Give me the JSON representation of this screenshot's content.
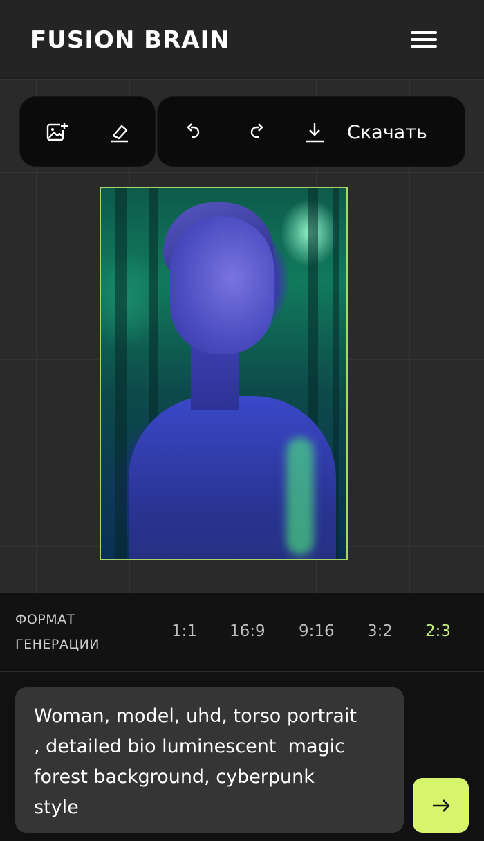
{
  "header": {
    "logo": "FUSION BRAIN",
    "menu_icon": "hamburger-menu-icon"
  },
  "toolbar": {
    "add_image_icon": "image-plus-icon",
    "eraser_icon": "eraser-icon",
    "undo_icon": "undo-icon",
    "redo_icon": "redo-icon",
    "download_icon": "download-icon",
    "download_label": "Скачать"
  },
  "image": {
    "accent_border": "#a8d66a"
  },
  "format": {
    "label_line1": "ФОРМАТ",
    "label_line2": "ГЕНЕРАЦИИ",
    "options": [
      "1:1",
      "16:9",
      "9:16",
      "3:2",
      "2:3"
    ],
    "selected": "2:3",
    "active_color": "#c4f07a"
  },
  "prompt": {
    "text": "Woman, model, uhd, torso portrait\n, detailed bio luminescent  magic\nforest background, cyberpunk\nstyle"
  },
  "send": {
    "icon": "arrow-right-icon",
    "color": "#d6f56d"
  }
}
